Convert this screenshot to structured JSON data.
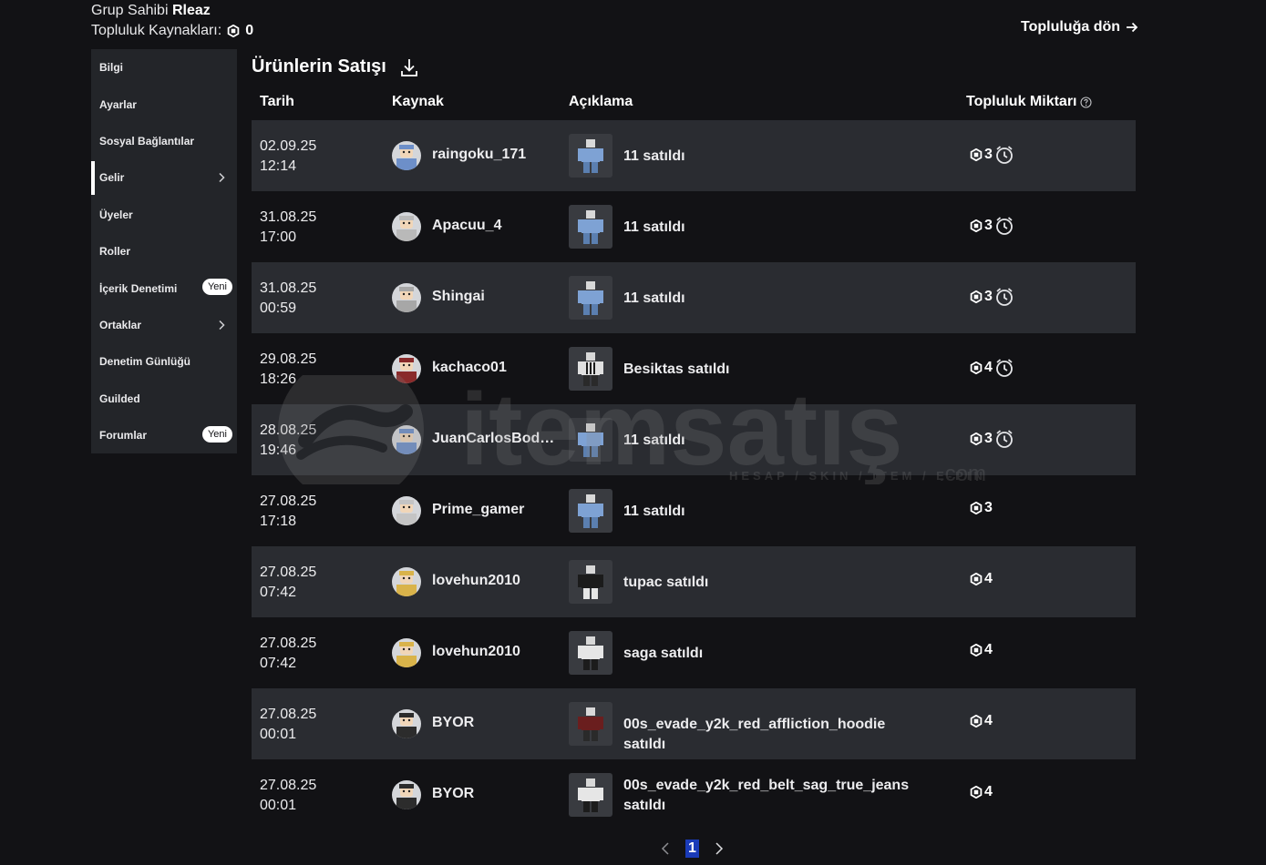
{
  "header": {
    "owner_label": "Grup Sahibi",
    "owner_name": "Rleaz",
    "funds_label": "Topluluk Kaynakları:",
    "funds_value": "0",
    "back_label": "Topluluğa dön"
  },
  "sidebar": {
    "items": [
      {
        "label": "Bilgi"
      },
      {
        "label": "Ayarlar"
      },
      {
        "label": "Sosyal Bağlantılar"
      },
      {
        "label": "Gelir"
      },
      {
        "label": "Üyeler"
      },
      {
        "label": "Roller"
      },
      {
        "label": "İçerik Denetimi",
        "badge": "Yeni"
      },
      {
        "label": "Ortaklar"
      },
      {
        "label": "Denetim Günlüğü"
      },
      {
        "label": "Guilded"
      },
      {
        "label": "Forumlar",
        "badge": "Yeni"
      }
    ],
    "active": "Gelir"
  },
  "main": {
    "title": "Ürünlerin Satışı",
    "columns": {
      "date": "Tarih",
      "source": "Kaynak",
      "description": "Açıklama",
      "amount": "Topluluk Miktarı"
    },
    "rows": [
      {
        "date": "02.09.25",
        "time": "12:14",
        "user": "raingoku_171",
        "desc": "11 satıldı",
        "amount": "3",
        "pending": true
      },
      {
        "date": "31.08.25",
        "time": "17:00",
        "user": "Apacuu_4",
        "desc": "11 satıldı",
        "amount": "3",
        "pending": true
      },
      {
        "date": "31.08.25",
        "time": "00:59",
        "user": "Shingai",
        "desc": "11 satıldı",
        "amount": "3",
        "pending": true
      },
      {
        "date": "29.08.25",
        "time": "18:26",
        "user": "kachaco01",
        "desc": "Besiktas satıldı",
        "amount": "4",
        "pending": true
      },
      {
        "date": "28.08.25",
        "time": "19:46",
        "user": "JuanCarlosBodo...",
        "desc": "11 satıldı",
        "amount": "3",
        "pending": true
      },
      {
        "date": "27.08.25",
        "time": "17:18",
        "user": "Prime_gamer",
        "desc": "11 satıldı",
        "amount": "3",
        "pending": false
      },
      {
        "date": "27.08.25",
        "time": "07:42",
        "user": "lovehun2010",
        "desc": "tupac satıldı",
        "amount": "4",
        "pending": false
      },
      {
        "date": "27.08.25",
        "time": "07:42",
        "user": "lovehun2010",
        "desc": "saga satıldı",
        "amount": "4",
        "pending": false
      },
      {
        "date": "27.08.25",
        "time": "00:01",
        "user": "BYOR",
        "desc": "00s_evade_y2k_red_affliction_hoodie satıldı",
        "amount": "4",
        "pending": false
      },
      {
        "date": "27.08.25",
        "time": "00:01",
        "user": "BYOR",
        "desc": "00s_evade_y2k_red_belt_sag_true_jeans satıldı",
        "amount": "4",
        "pending": false
      }
    ]
  },
  "pagination": {
    "current": "1"
  },
  "watermark": {
    "brand": "itemsatış",
    "tagline": "HESAP / SKIN / ITEM / E-PIN",
    "suffix": ".com"
  },
  "icons": {
    "robux": "robux-icon",
    "pending": "clock-icon",
    "download": "download-icon",
    "info": "info-icon"
  }
}
